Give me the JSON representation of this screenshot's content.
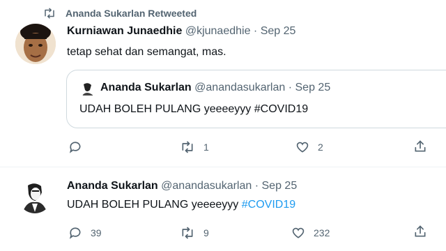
{
  "retweet_header": {
    "label": "Ananda Sukarlan Retweeted",
    "icon": "retweet-icon"
  },
  "reply_tweet": {
    "display_name": "Kurniawan Junaedhie",
    "handle": "@kjunaedhie",
    "separator": "·",
    "date": "Sep 25",
    "text": "tetap sehat dan semangat, mas.",
    "quoted": {
      "display_name": "Ananda Sukarlan",
      "handle": "@anandasukarlan",
      "separator": "·",
      "date": "Sep 25",
      "text": "UDAH BOLEH PULANG yeeeeyyy #COVID19"
    },
    "actions": {
      "reply_count": "",
      "retweet_count": "1",
      "like_count": "2"
    }
  },
  "main_tweet": {
    "display_name": "Ananda Sukarlan",
    "handle": "@anandasukarlan",
    "separator": "·",
    "date": "Sep 25",
    "text_plain": "UDAH BOLEH PULANG yeeeeyyy ",
    "hashtag": "#COVID19",
    "actions": {
      "reply_count": "39",
      "retweet_count": "9",
      "like_count": "232"
    }
  },
  "colors": {
    "accent": "#1d9bf0",
    "muted": "#536471",
    "text": "#0f1419",
    "border": "#cfd9de"
  }
}
